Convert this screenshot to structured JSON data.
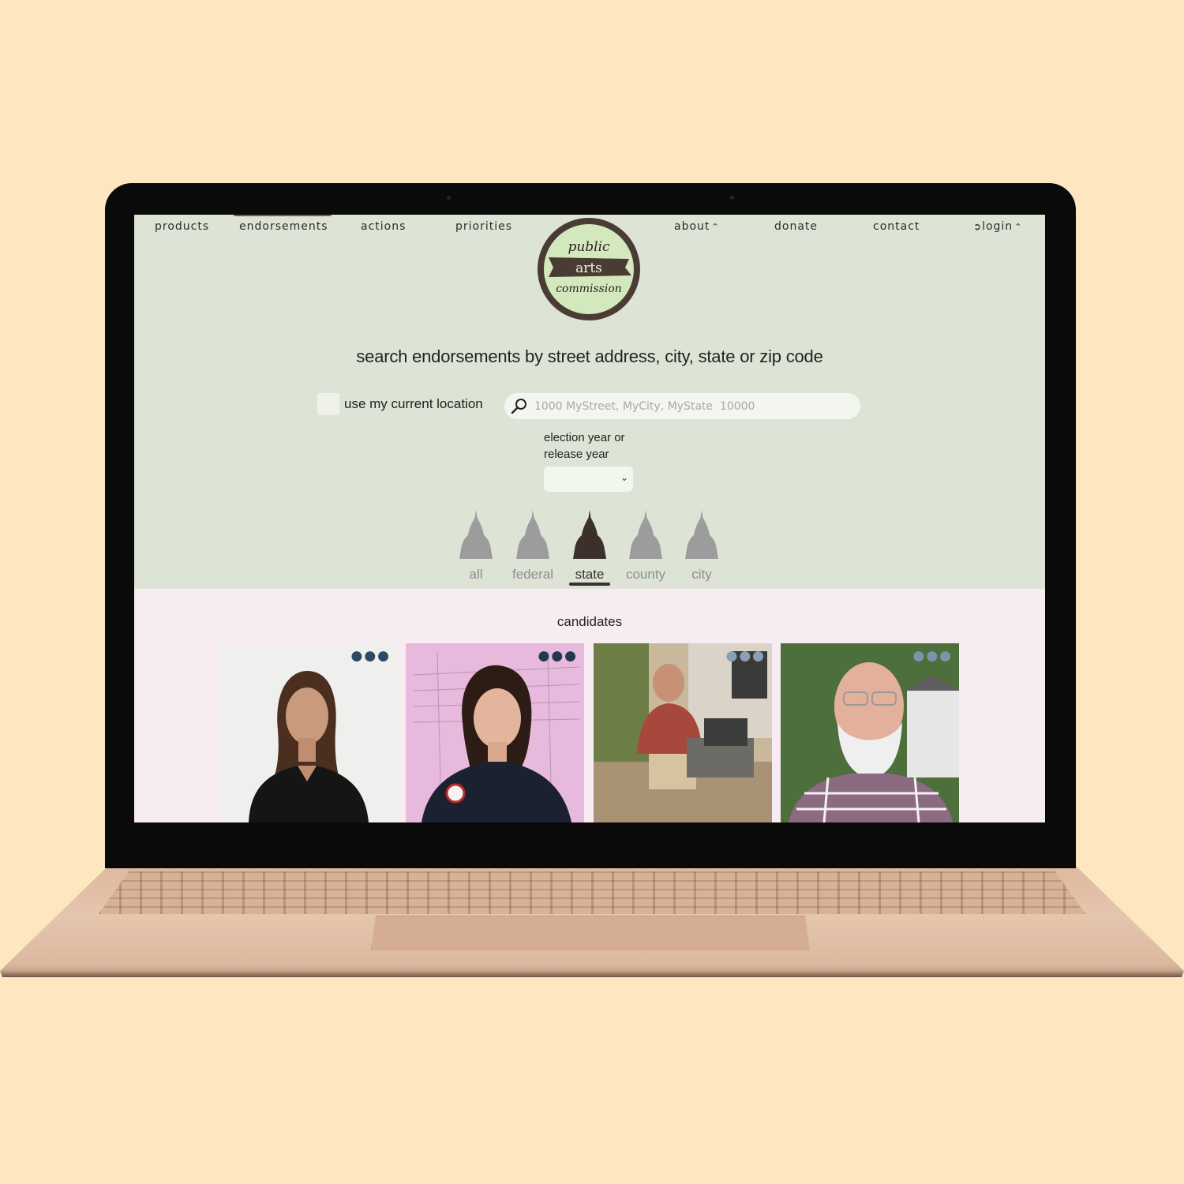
{
  "nav": {
    "products": "products",
    "endorsements": "endorsements",
    "actions": "actions",
    "priorities": "priorities",
    "about": "about",
    "donate": "donate",
    "contact": "contact",
    "login": "login",
    "active": "endorsements"
  },
  "logo": {
    "line1": "public",
    "line2": "arts",
    "line3": "commission"
  },
  "search": {
    "heading": "search endorsements by street address, city, state or zip code",
    "use_location_label": "use my current location",
    "use_location_checked": false,
    "address_placeholder": "1000 MyStreet, MyCity, MyState  10000",
    "address_value": "",
    "year_label_line1": "election year or",
    "year_label_line2": "release year",
    "year_selected": ""
  },
  "levels": {
    "items": [
      "all",
      "federal",
      "state",
      "county",
      "city"
    ],
    "selected": "state"
  },
  "candidates": {
    "title": "candidates"
  },
  "colors": {
    "page_bg": "#fde7c1",
    "header_bg": "#dde4d5",
    "candidates_bg": "#f8ecf3",
    "dark_brown": "#3b302a",
    "inactive_gray": "#8e8e8e",
    "logo_green": "#d4e8bd"
  }
}
